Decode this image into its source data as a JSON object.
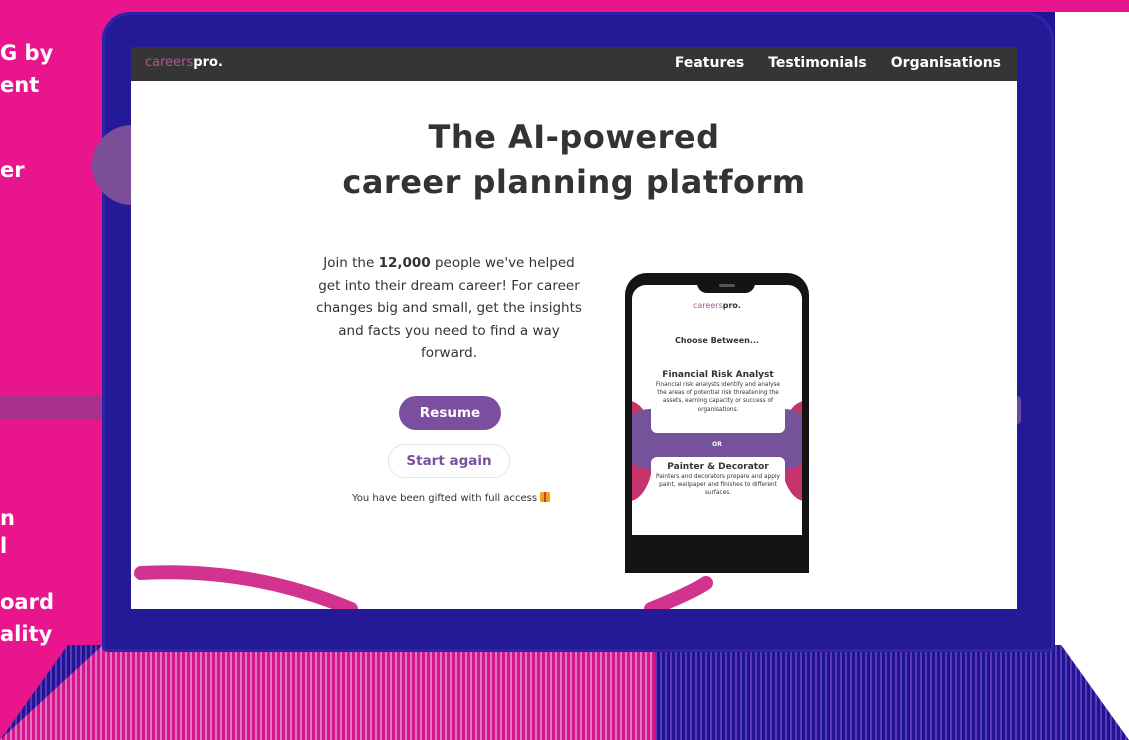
{
  "background_text": [
    "G by",
    "ent",
    "er",
    "n",
    "l",
    "oard",
    "ality"
  ],
  "app": {
    "logo_prefix": "careers",
    "logo_suffix": "pro."
  },
  "nav": {
    "items": [
      "Features",
      "Testimonials",
      "Organisations"
    ]
  },
  "hero": {
    "title_line1": "The AI-powered",
    "title_line2": "career planning platform",
    "lede_part1": "Join the ",
    "lede_highlight": "12,000",
    "lede_part2": " people we've helped get into their dream career! For career changes big and small, get the insights and facts you need to find a way forward."
  },
  "actions": {
    "resume_label": "Resume",
    "restart_label": "Start again",
    "gift_note": "You have been gifted with full access"
  },
  "phone": {
    "logo_prefix": "careers",
    "logo_suffix": "pro.",
    "choose_label": "Choose Between...",
    "divider_label": "OR",
    "cards": [
      {
        "title": "Financial Risk Analyst",
        "description": "Financial risk analysts identify and analyse the areas of potential risk threatening the assets, earning capacity or success of organisations."
      },
      {
        "title": "Painter & Decorator",
        "description": "Painters and decorators prepare and apply paint, wallpaper and finishes to different surfaces."
      }
    ]
  },
  "colors": {
    "brand_pink": "#e8158c",
    "laptop_blue": "#241996",
    "accent_purple": "#7b4fa0",
    "navbar": "#353535"
  },
  "icons": {
    "gift": "gift-icon"
  }
}
